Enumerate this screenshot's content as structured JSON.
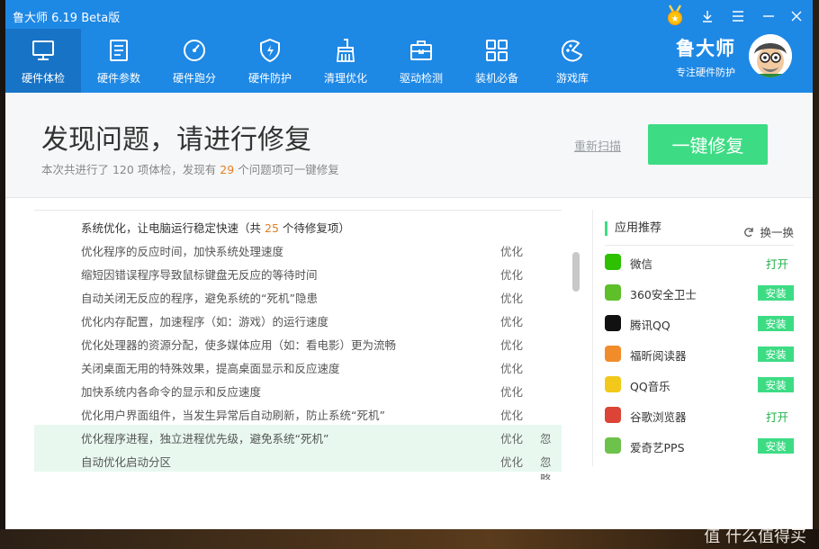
{
  "window": {
    "title": "鲁大师 6.19 Beta版"
  },
  "nav": [
    {
      "label": "硬件体检",
      "icon": "monitor-icon",
      "active": true
    },
    {
      "label": "硬件参数",
      "icon": "list-icon"
    },
    {
      "label": "硬件跑分",
      "icon": "speedometer-icon"
    },
    {
      "label": "硬件防护",
      "icon": "shield-icon"
    },
    {
      "label": "清理优化",
      "icon": "broom-icon"
    },
    {
      "label": "驱动检测",
      "icon": "toolbox-icon"
    },
    {
      "label": "装机必备",
      "icon": "apps-grid-icon"
    },
    {
      "label": "游戏库",
      "icon": "gamepad-icon"
    }
  ],
  "brand": {
    "name": "鲁大师",
    "slogan": "专注硬件防护"
  },
  "header": {
    "title": "发现问题，请进行修复",
    "sub_prefix": "本次共进行了 120 项体检，发现有",
    "sub_count": "29",
    "sub_suffix": "个问题项可一键修复",
    "rescan": "重新扫描",
    "fix_button": "一键修复"
  },
  "group": {
    "prefix": "系统优化，让电脑运行稳定快速（共",
    "count": "25",
    "suffix": "个待修复项）"
  },
  "rows": [
    {
      "text": "优化程序的反应时间，加快系统处理速度",
      "action": "优化",
      "ignore": ""
    },
    {
      "text": "缩短因错误程序导致鼠标键盘无反应的等待时间",
      "action": "优化",
      "ignore": ""
    },
    {
      "text": "自动关闭无反应的程序，避免系统的“死机”隐患",
      "action": "优化",
      "ignore": ""
    },
    {
      "text": "优化内存配置，加速程序（如：游戏）的运行速度",
      "action": "优化",
      "ignore": ""
    },
    {
      "text": "优化处理器的资源分配，使多媒体应用（如：看电影）更为流畅",
      "action": "优化",
      "ignore": ""
    },
    {
      "text": "关闭桌面无用的特殊效果，提高桌面显示和反应速度",
      "action": "优化",
      "ignore": ""
    },
    {
      "text": "加快系统内各命令的显示和反应速度",
      "action": "优化",
      "ignore": ""
    },
    {
      "text": "优化用户界面组件，当发生异常后自动刷新，防止系统“死机”",
      "action": "优化",
      "ignore": ""
    },
    {
      "text": "优化程序进程，独立进程优先级，避免系统“死机”",
      "action": "优化",
      "ignore": "忽略",
      "highlight": true
    },
    {
      "text": "自动优化启动分区",
      "action": "优化",
      "ignore": "忽略",
      "highlight": true
    }
  ],
  "recommend": {
    "title": "应用推荐",
    "refresh": "换一换",
    "apps": [
      {
        "name": "微信",
        "button": "打开",
        "type": "open",
        "icon": "wechat-icon",
        "color": "#2dc100"
      },
      {
        "name": "360安全卫士",
        "button": "安装",
        "type": "install",
        "icon": "360-icon",
        "color": "#5fbf2b"
      },
      {
        "name": "腾讯QQ",
        "button": "安装",
        "type": "install",
        "icon": "qq-icon",
        "color": "#111111"
      },
      {
        "name": "福昕阅读器",
        "button": "安装",
        "type": "install",
        "icon": "foxit-icon",
        "color": "#f08c2a"
      },
      {
        "name": "QQ音乐",
        "button": "安装",
        "type": "install",
        "icon": "qqmusic-icon",
        "color": "#f2c81b"
      },
      {
        "name": "谷歌浏览器",
        "button": "打开",
        "type": "open",
        "icon": "chrome-icon",
        "color": "#db4437"
      },
      {
        "name": "爱奇艺PPS",
        "button": "安装",
        "type": "install",
        "icon": "iqiyi-icon",
        "color": "#6cc24a"
      }
    ]
  },
  "watermark": "值 什么值得买"
}
